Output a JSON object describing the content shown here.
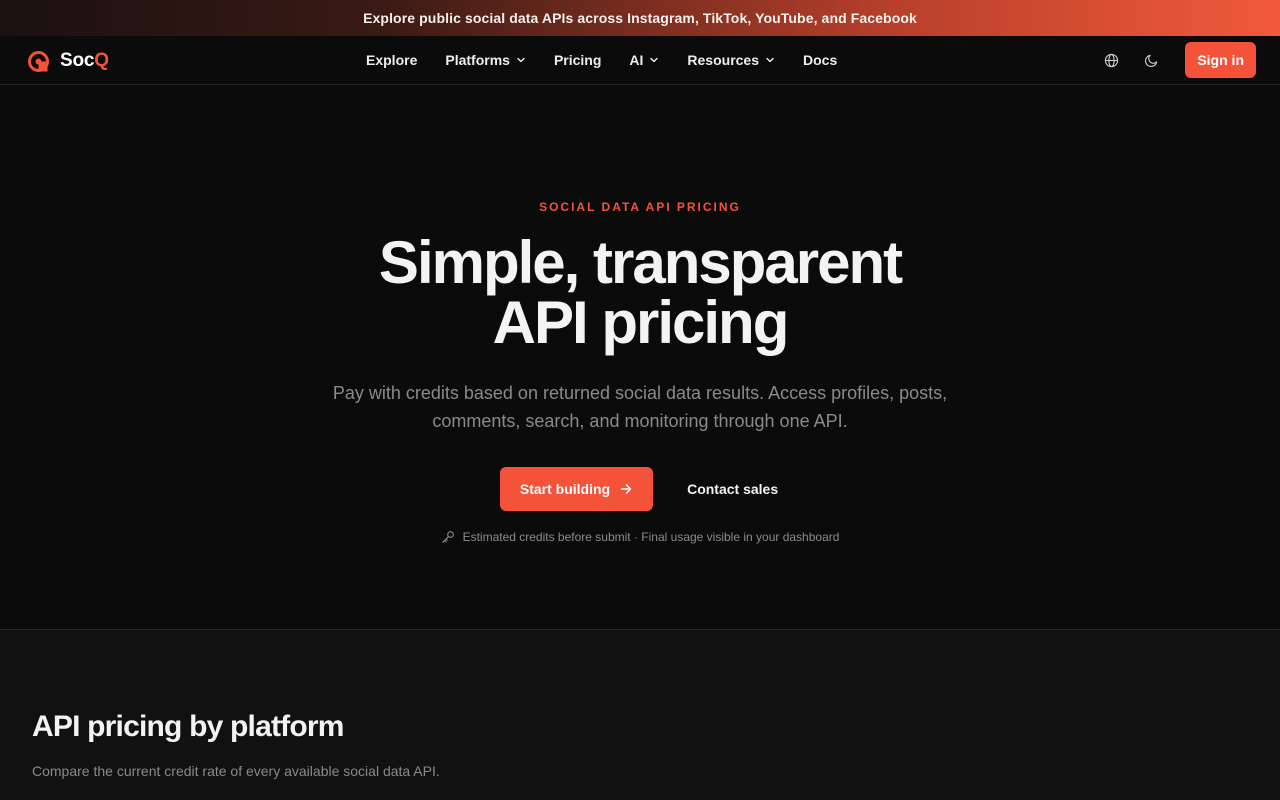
{
  "banner": {
    "text": "Explore public social data APIs across Instagram, TikTok, YouTube, and Facebook"
  },
  "logo": {
    "text_main": "Soc",
    "text_accent": "Q"
  },
  "nav": {
    "links": [
      {
        "label": "Explore",
        "has_dropdown": false
      },
      {
        "label": "Platforms",
        "has_dropdown": true
      },
      {
        "label": "Pricing",
        "has_dropdown": false
      },
      {
        "label": "AI",
        "has_dropdown": true
      },
      {
        "label": "Resources",
        "has_dropdown": true
      },
      {
        "label": "Docs",
        "has_dropdown": false
      }
    ],
    "language_icon": "globe-icon",
    "theme_icon": "moon-icon",
    "signin_label": "Sign in"
  },
  "hero": {
    "eyebrow": "SOCIAL DATA API PRICING",
    "headline_line1": "Simple, transparent",
    "headline_line2": "API pricing",
    "subtitle_line1": "Pay with credits based on returned social data results. Access profiles, posts,",
    "subtitle_line2": "comments, search, and monitoring through one API.",
    "primary_cta": "Start building",
    "secondary_cta": "Contact sales",
    "note": "Estimated credits before submit · Final usage visible in your dashboard",
    "note_icon": "key-icon"
  },
  "pricing_section": {
    "title": "API pricing by platform",
    "subtitle": "Compare the current credit rate of every available social data API."
  },
  "colors": {
    "accent": "#f4533a",
    "background": "#0b0b0b",
    "section_background": "#111111",
    "muted_text": "#8a8a8a"
  }
}
